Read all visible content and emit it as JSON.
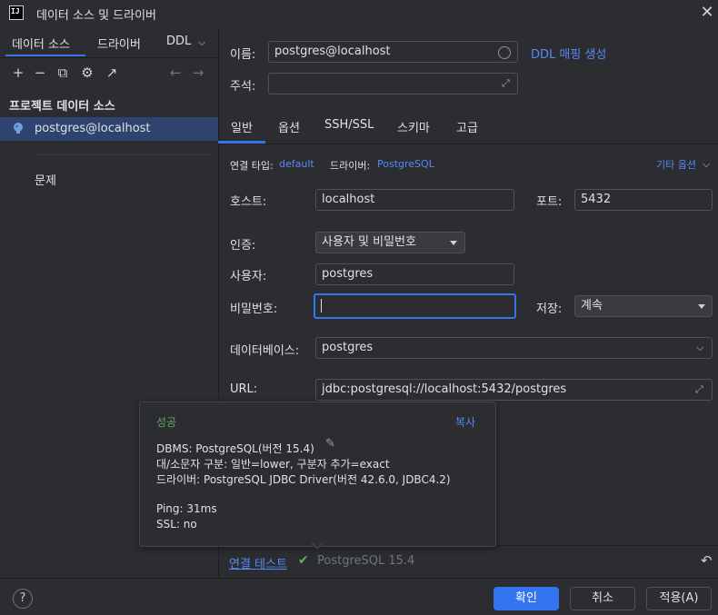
{
  "window": {
    "title": "데이터 소스 및 드라이버",
    "logo_text": "IJ"
  },
  "left": {
    "tabs": [
      "데이터 소스",
      "드라이버",
      "DDL"
    ],
    "section_title": "프로젝트 데이터 소스",
    "selected_source": "postgres@localhost",
    "problems": "문제"
  },
  "top": {
    "name_label": "이름:",
    "name_value": "postgres@localhost",
    "ddl_link": "DDL 매핑 생성",
    "comment_label": "주석:",
    "comment_value": ""
  },
  "tabs": [
    "일반",
    "옵션",
    "SSH/SSL",
    "스키마",
    "고급"
  ],
  "connection": {
    "type_label": "연결 타입:",
    "type_value": "default",
    "driver_label": "드라이버:",
    "driver_value": "PostgreSQL",
    "more_options": "기타 옵션"
  },
  "form": {
    "host_label": "호스트:",
    "host_value": "localhost",
    "port_label": "포트:",
    "port_value": "5432",
    "auth_label": "인증:",
    "auth_value": "사용자 및 비밀번호",
    "user_label": "사용자:",
    "user_value": "postgres",
    "password_label": "비밀번호:",
    "password_value": "",
    "save_label": "저장:",
    "save_value": "계속",
    "database_label": "데이터베이스:",
    "database_value": "postgres",
    "url_label": "URL:",
    "url_value": "jdbc:postgresql://localhost:5432/postgres"
  },
  "popup": {
    "status": "성공",
    "copy": "복사",
    "line1": "DBMS: PostgreSQL(버전 15.4)",
    "line2": "대/소문자 구분: 일반=lower, 구분자 추가=exact",
    "line3": "드라이버: PostgreSQL JDBC Driver(버전 42.6.0, JDBC4.2)",
    "line4": "Ping: 31ms",
    "line5": "SSL: no"
  },
  "test": {
    "link": "연결 테스트",
    "result": "PostgreSQL 15.4"
  },
  "footer": {
    "help": "?",
    "ok": "확인",
    "cancel": "취소",
    "apply": "적용(A)"
  },
  "colors": {
    "accent": "#3574f0",
    "success": "#5fad65",
    "link": "#548af7",
    "selection": "#2e436e"
  }
}
